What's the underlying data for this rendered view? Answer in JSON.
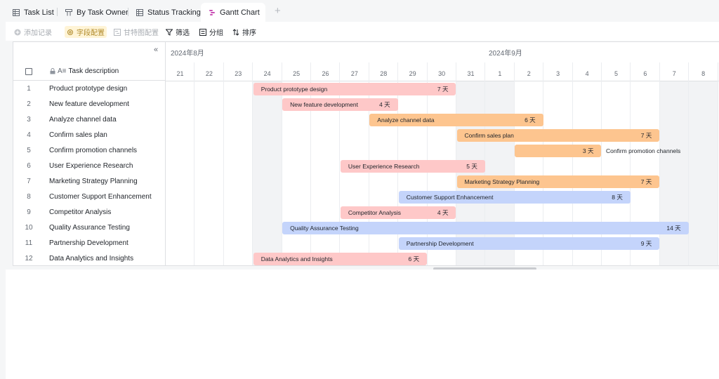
{
  "tabs": [
    {
      "label": "Task List",
      "icon": "table-icon",
      "active": false
    },
    {
      "label": "By Task Owner",
      "icon": "kanban-icon",
      "active": false
    },
    {
      "label": "Status Tracking",
      "icon": "table-icon",
      "active": false
    },
    {
      "label": "Gantt Chart",
      "icon": "gantt-icon",
      "active": true
    }
  ],
  "add_tab_label": "+",
  "toolbar": {
    "add_record": "添加记录",
    "field_config": "字段配置",
    "gantt_config": "甘特图配置",
    "filter": "筛选",
    "group": "分组",
    "sort": "排序"
  },
  "collapse_label": "«",
  "column_title": "Task description",
  "timeline": {
    "months": [
      {
        "label": "2024年8月",
        "start_index": 0
      },
      {
        "label": "2024年9月",
        "start_index": 11
      }
    ],
    "days": [
      "21",
      "22",
      "23",
      "24",
      "25",
      "26",
      "27",
      "28",
      "29",
      "30",
      "31",
      "1",
      "2",
      "3",
      "4",
      "5",
      "6",
      "7",
      "8"
    ],
    "weekend_indices": [
      3,
      10,
      11,
      17,
      18
    ]
  },
  "tasks": [
    {
      "num": "1",
      "name": "Product prototype design",
      "start": 3,
      "span": 7,
      "duration": "7 天",
      "color": "#fec8c8"
    },
    {
      "num": "2",
      "name": "New feature development",
      "start": 4,
      "span": 4,
      "duration": "4 天",
      "color": "#fec8c8"
    },
    {
      "num": "3",
      "name": "Analyze channel data",
      "start": 7,
      "span": 6,
      "duration": "6 天",
      "color": "#fdc58f"
    },
    {
      "num": "4",
      "name": "Confirm sales plan",
      "start": 10,
      "span": 7,
      "duration": "7 天",
      "color": "#fdc58f"
    },
    {
      "num": "5",
      "name": "Confirm promotion channels",
      "start": 12,
      "span": 3,
      "duration": "3 天",
      "color": "#fdc58f",
      "label_outside": true
    },
    {
      "num": "6",
      "name": "User Experience Research",
      "start": 6,
      "span": 5,
      "duration": "5 天",
      "color": "#fec8c8"
    },
    {
      "num": "7",
      "name": "Marketing Strategy Planning",
      "start": 10,
      "span": 7,
      "duration": "7 天",
      "color": "#fdc58f"
    },
    {
      "num": "8",
      "name": "Customer Support Enhancement",
      "start": 8,
      "span": 8,
      "duration": "8 天",
      "color": "#c4d4fb"
    },
    {
      "num": "9",
      "name": "Competitor Analysis",
      "start": 6,
      "span": 4,
      "duration": "4 天",
      "color": "#fec8c8"
    },
    {
      "num": "10",
      "name": "Quality Assurance Testing",
      "start": 4,
      "span": 14,
      "duration": "14 天",
      "color": "#c4d4fb"
    },
    {
      "num": "11",
      "name": "Partnership Development",
      "start": 8,
      "span": 9,
      "duration": "9 天",
      "color": "#c4d4fb"
    },
    {
      "num": "12",
      "name": "Data Analytics and Insights",
      "start": 3,
      "span": 6,
      "duration": "6 天",
      "color": "#fec8c8"
    }
  ]
}
